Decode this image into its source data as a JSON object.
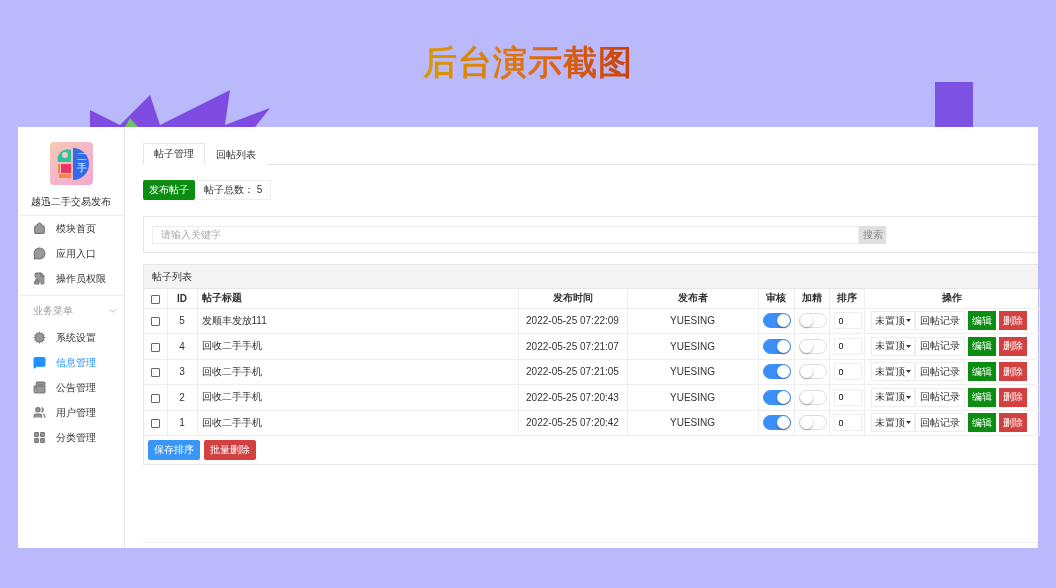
{
  "banner": {
    "title": "后台演示截图"
  },
  "sidebar": {
    "app_name": "越迅二手交易发布",
    "logo_text": "二手",
    "items": [
      {
        "label": "模块首页",
        "selected": false
      },
      {
        "label": "应用入口",
        "selected": false
      },
      {
        "label": "操作员权限",
        "selected": false
      }
    ],
    "group": {
      "label": "业务菜单",
      "expanded": true,
      "items": [
        {
          "label": "系统设置",
          "selected": false
        },
        {
          "label": "信息管理",
          "selected": true
        },
        {
          "label": "公告管理",
          "selected": false
        },
        {
          "label": "用户管理",
          "selected": false
        },
        {
          "label": "分类管理",
          "selected": false
        }
      ]
    }
  },
  "tabs": [
    {
      "label": "帖子管理",
      "selected": true
    },
    {
      "label": "回帖列表",
      "selected": false
    }
  ],
  "actions": {
    "publish": "发布帖子",
    "total_label": "帖子总数：",
    "total": "5"
  },
  "search": {
    "placeholder": "请输入关键字",
    "button": "搜索"
  },
  "table": {
    "title": "帖子列表",
    "select_all_checked": false,
    "columns": [
      "ID",
      "帖子标题",
      "发布时间",
      "发布者",
      "审核",
      "加精",
      "排序",
      "操作"
    ],
    "rows": [
      {
        "checked": false,
        "id": "5",
        "title": "发顺丰发放111",
        "time": "2022-05-25 07:22:09",
        "author": "YUESING",
        "approved": true,
        "featured": false,
        "sort": "0",
        "pin": "未置顶",
        "replies": "回帖记录",
        "edit": "编辑",
        "delete": "删除"
      },
      {
        "checked": false,
        "id": "4",
        "title": "回收二手手机",
        "time": "2022-05-25 07:21:07",
        "author": "YUESING",
        "approved": true,
        "featured": false,
        "sort": "0",
        "pin": "未置顶",
        "replies": "回帖记录",
        "edit": "编辑",
        "delete": "删除"
      },
      {
        "checked": false,
        "id": "3",
        "title": "回收二手手机",
        "time": "2022-05-25 07:21:05",
        "author": "YUESING",
        "approved": true,
        "featured": false,
        "sort": "0",
        "pin": "未置顶",
        "replies": "回帖记录",
        "edit": "编辑",
        "delete": "删除"
      },
      {
        "checked": false,
        "id": "2",
        "title": "回收二手手机",
        "time": "2022-05-25 07:20:43",
        "author": "YUESING",
        "approved": true,
        "featured": false,
        "sort": "0",
        "pin": "未置顶",
        "replies": "回帖记录",
        "edit": "编辑",
        "delete": "删除"
      },
      {
        "checked": false,
        "id": "1",
        "title": "回收二手手机",
        "time": "2022-05-25 07:20:42",
        "author": "YUESING",
        "approved": true,
        "featured": false,
        "sort": "0",
        "pin": "未置顶",
        "replies": "回帖记录",
        "edit": "编辑",
        "delete": "删除"
      }
    ],
    "footer_buttons": [
      "保存排序",
      "批量删除"
    ]
  }
}
